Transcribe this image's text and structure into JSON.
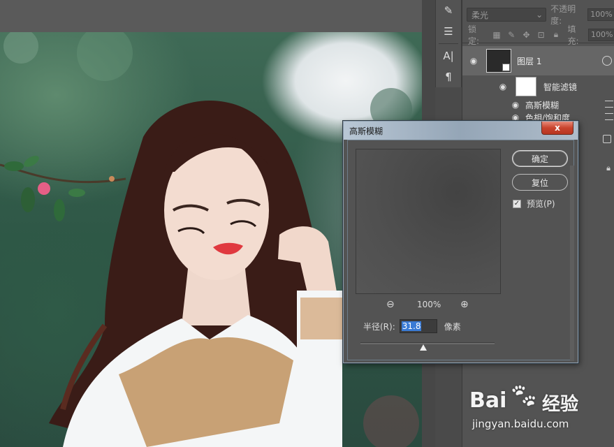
{
  "layers_panel": {
    "blend_mode": "柔光",
    "opacity_label": "不透明度:",
    "opacity_value": "100%",
    "lock_label": "锁定:",
    "fill_label": "填充:",
    "fill_value": "100%",
    "layer_name": "图层 1",
    "smart_filter_label": "智能滤镜",
    "filters": [
      "高斯模糊",
      "色相/饱和度"
    ]
  },
  "dialog": {
    "title": "高斯模糊",
    "close_label": "x",
    "ok_label": "确定",
    "reset_label": "复位",
    "preview_label": "预览(P)",
    "preview_checked": true,
    "zoom_value": "100%",
    "radius_label": "半径(R):",
    "radius_value": "31.8",
    "unit_label": "像素",
    "slider_fraction": 0.47
  },
  "watermark": {
    "brand_left": "Bai",
    "brand_right": "经验",
    "url": "jingyan.baidu.com"
  },
  "colors": {
    "panel_bg": "#535353",
    "selection_blue": "#3a7bd5",
    "close_red": "#c9442e"
  }
}
